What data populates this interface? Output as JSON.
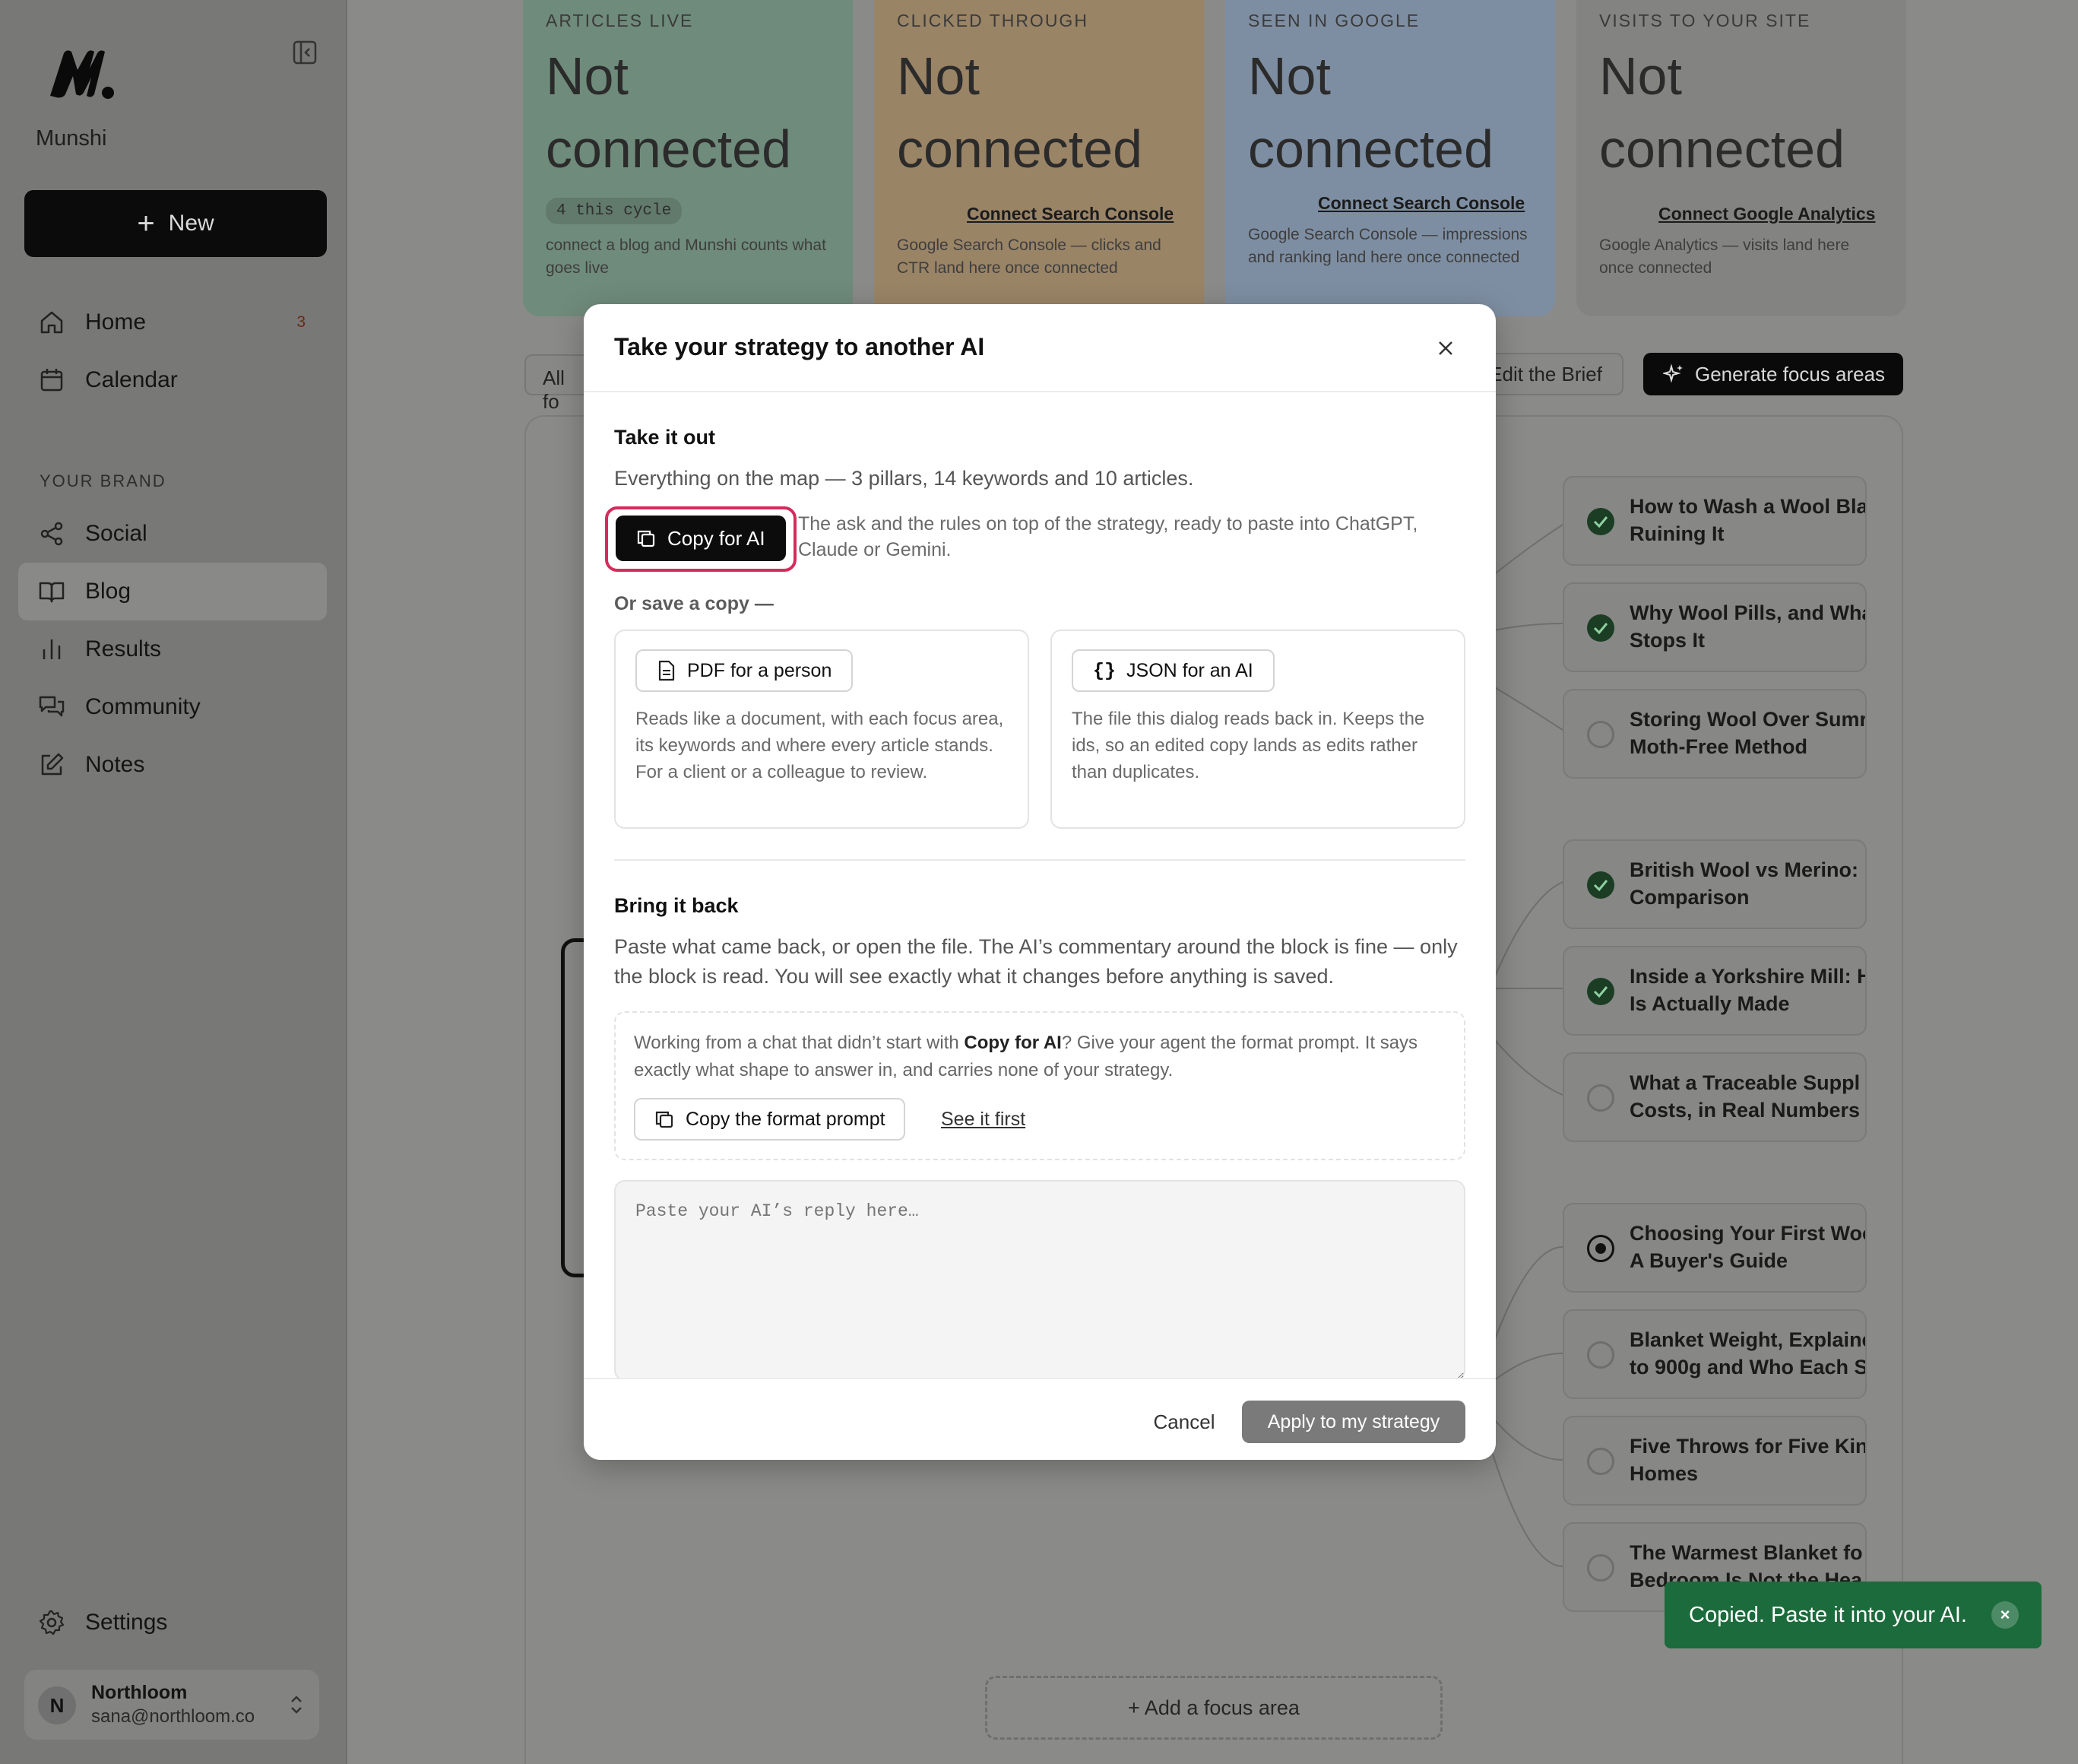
{
  "sidebar": {
    "brand": "Munshi",
    "new_label": "New",
    "nav": [
      {
        "label": "Home",
        "badge": "3"
      },
      {
        "label": "Calendar"
      }
    ],
    "section_label": "YOUR BRAND",
    "brand_nav": [
      {
        "label": "Social"
      },
      {
        "label": "Blog"
      },
      {
        "label": "Results"
      },
      {
        "label": "Community"
      },
      {
        "label": "Notes"
      }
    ],
    "active_item": "Blog",
    "settings_label": "Settings",
    "account": {
      "initial": "N",
      "name": "Northloom",
      "email": "sana@northloom.co"
    }
  },
  "stats": [
    {
      "label": "ARTICLES LIVE",
      "value": "Not connected",
      "pill": "4 this cycle",
      "desc": "connect a blog and Munshi counts what goes live",
      "color": "#6f8b7b"
    },
    {
      "label": "CLICKED THROUGH",
      "value": "Not connected",
      "link": "Connect Search Console",
      "desc": "Google Search Console — clicks and CTR land here once connected",
      "color": "#9a8466"
    },
    {
      "label": "SEEN IN GOOGLE",
      "value": "Not connected",
      "link": "Connect Search Console",
      "desc": "Google Search Console — impressions and ranking land here once connected",
      "color": "#7e8ea2"
    },
    {
      "label": "VISITS TO YOUR SITE",
      "value": "Not connected",
      "link": "Connect Google Analytics",
      "desc": "Google Analytics — visits land here once connected",
      "color": "#838381"
    }
  ],
  "toolbar": {
    "filter_label": "All fo",
    "edit_brief": "Edit the Brief",
    "generate": "Generate focus areas"
  },
  "articles": [
    {
      "line1": "How to Wash a Wool Bla",
      "line2": "Ruining It",
      "status": "done"
    },
    {
      "line1": "Why Wool Pills, and Wha",
      "line2": "Stops It",
      "status": "done"
    },
    {
      "line1": "Storing Wool Over Sumr",
      "line2": "Moth-Free Method",
      "status": "todo"
    },
    {
      "line1": "British Wool vs Merino: .",
      "line2": "Comparison",
      "status": "done"
    },
    {
      "line1": "Inside a Yorkshire Mill: H",
      "line2": "Is Actually Made",
      "status": "done"
    },
    {
      "line1": "What a Traceable Suppl",
      "line2": "Costs, in Real Numbers",
      "status": "todo"
    },
    {
      "line1": "Choosing Your First Woo",
      "line2": "A Buyer's Guide",
      "status": "current"
    },
    {
      "line1": "Blanket Weight, Explaine",
      "line2": "to 900g and Who Each S",
      "status": "todo"
    },
    {
      "line1": "Five Throws for Five Kin",
      "line2": "Homes",
      "status": "todo"
    },
    {
      "line1": "The Warmest Blanket fo",
      "line2": "Bedroom Is Not the Hea",
      "status": "todo"
    }
  ],
  "add_focus": "+ Add a focus area",
  "modal": {
    "title": "Take your strategy to another AI",
    "take_out_title": "Take it out",
    "take_out_text": "Everything on the map — 3 pillars, 14 keywords and 10 articles.",
    "copy_ai_label": "Copy for AI",
    "copy_ai_desc": "The ask and the rules on top of the strategy, ready to paste into ChatGPT, Claude or Gemini.",
    "or_save": "Or save a copy —",
    "pdf_label": "PDF for a person",
    "pdf_desc": "Reads like a document, with each focus area, its keywords and where every article stands. For a client or a colleague to review.",
    "json_label": "JSON for an AI",
    "json_desc": "The file this dialog reads back in. Keeps the ids, so an edited copy lands as edits rather than duplicates.",
    "bring_back_title": "Bring it back",
    "bring_back_text": "Paste what came back, or open the file. The AI’s commentary around the block is fine — only the block is read. You will see exactly what it changes before anything is saved.",
    "format_pre": "Working from a chat that didn’t start with ",
    "format_bold": "Copy for AI",
    "format_post": "? Give your agent the format prompt. It says exactly what shape to answer in, and carries none of your strategy.",
    "copy_format_label": "Copy the format prompt",
    "see_first": "See it first",
    "paste_placeholder": "Paste your AI’s reply here…",
    "cancel": "Cancel",
    "apply": "Apply to my strategy"
  },
  "toast": {
    "text": "Copied. Paste it into your AI.",
    "close": "×"
  }
}
